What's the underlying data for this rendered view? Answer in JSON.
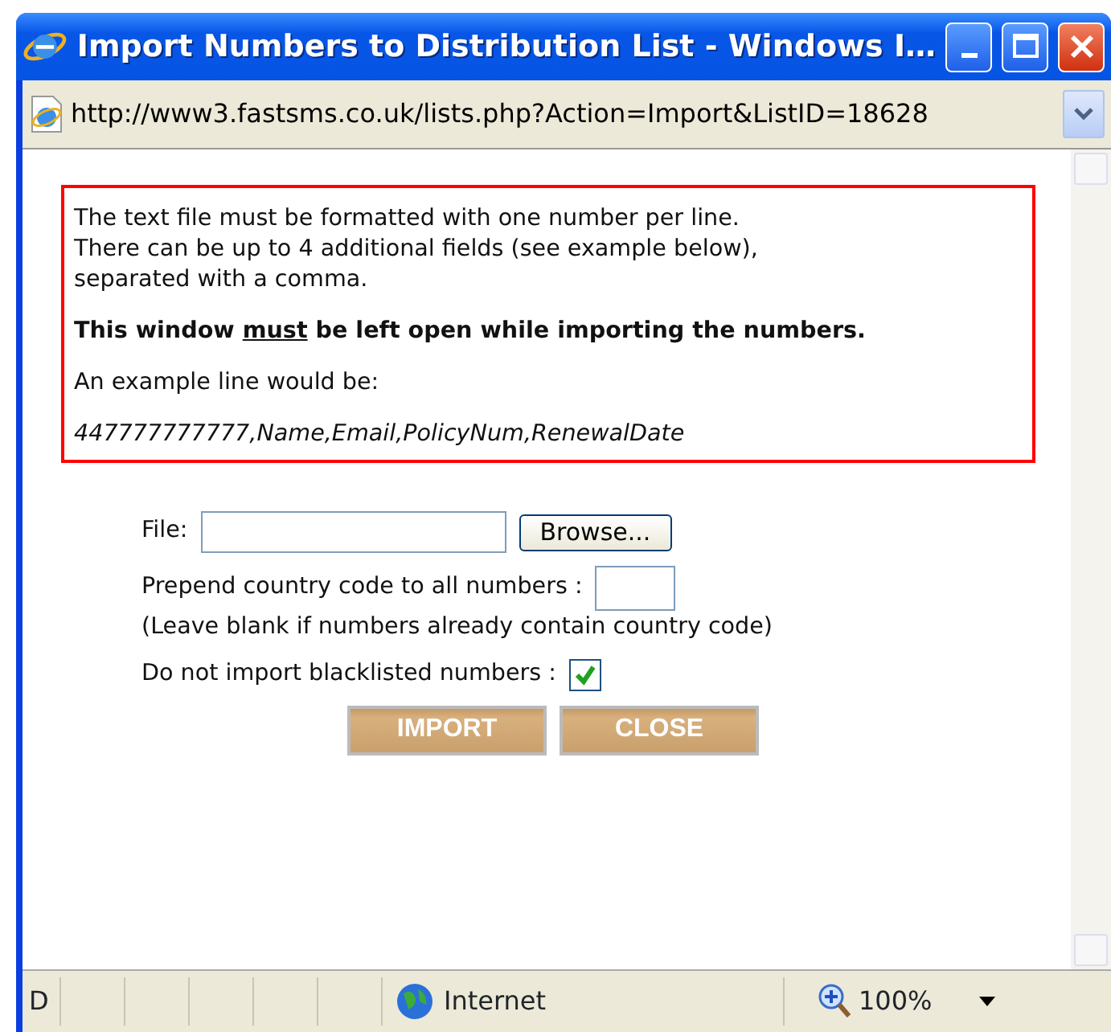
{
  "window": {
    "title": "Import Numbers to Distribution List - Windows I…"
  },
  "address_bar": {
    "url": "http://www3.fastsms.co.uk/lists.php?Action=Import&ListID=18628"
  },
  "notice": {
    "paragraphs": [
      "The text file must be formatted with one number per line.\nThere can be up to 4 additional fields (see example below),\nseparated with a comma."
    ],
    "warning": {
      "before": "This window ",
      "underlined": "must",
      "after": " be left open while importing the numbers."
    },
    "example_label": "An example line would be:",
    "example_line": "447777777777,Name,Email,PolicyNum,RenewalDate"
  },
  "form": {
    "file_label": "File:",
    "browse_button": "Browse...",
    "country_code_label": "Prepend country code to all numbers :",
    "country_code_hint": "(Leave blank if numbers already contain country code)",
    "blacklist_label": "Do not import blacklisted numbers :",
    "blacklist_checked": true,
    "buttons": [
      "IMPORT",
      "CLOSE"
    ]
  },
  "status_bar": {
    "cut_text": "D",
    "zone": "Internet",
    "zoom": "100%"
  }
}
